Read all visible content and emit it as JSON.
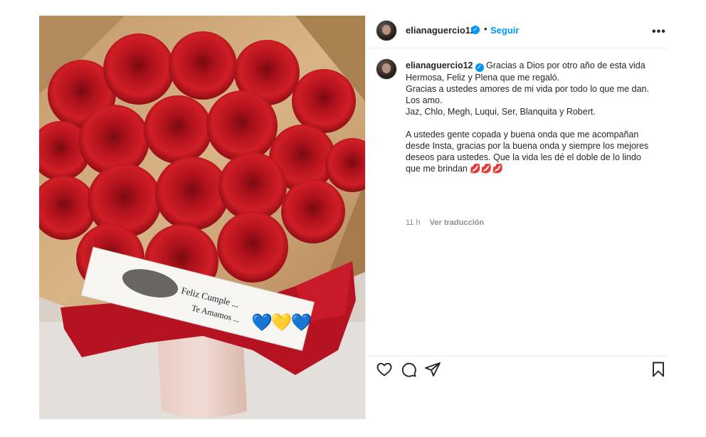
{
  "post": {
    "username": "elianaguercio12",
    "follow_label": "Seguir",
    "separator": "•",
    "more_label": "•••",
    "caption": {
      "line1": "Gracias a Dios por otro año de esta vida Hermosa, Feliz y Plena que me regaló.",
      "line2": "Gracias a ustedes amores de mi vida por todo lo que me dan. Los amo.",
      "line3": "Jaz, Chlo, Megh, Luqui, Ser, Blanquita y Robert.",
      "para2": "A ustedes gente copada y buena onda que me acompañan desde Insta, gracias por la buena onda y siempre los mejores deseos para ustedes. Que la vida les dé el doble de lo lindo que me brindan 💋💋💋"
    },
    "time": "11 h",
    "translate_label": "Ver traducción",
    "photo": {
      "card_line1": "Feliz Cumple ...",
      "card_line2": "Te Amamos ...",
      "hearts": "💙💛💙"
    }
  },
  "colors": {
    "accent": "#0095f6",
    "text": "#262626",
    "muted": "#8e8e8e",
    "border": "#efefef"
  },
  "icons": {
    "verified": "verified-badge-icon",
    "like": "heart-icon",
    "comment": "comment-icon",
    "share": "share-icon",
    "save": "bookmark-icon",
    "more": "more-options-icon"
  }
}
